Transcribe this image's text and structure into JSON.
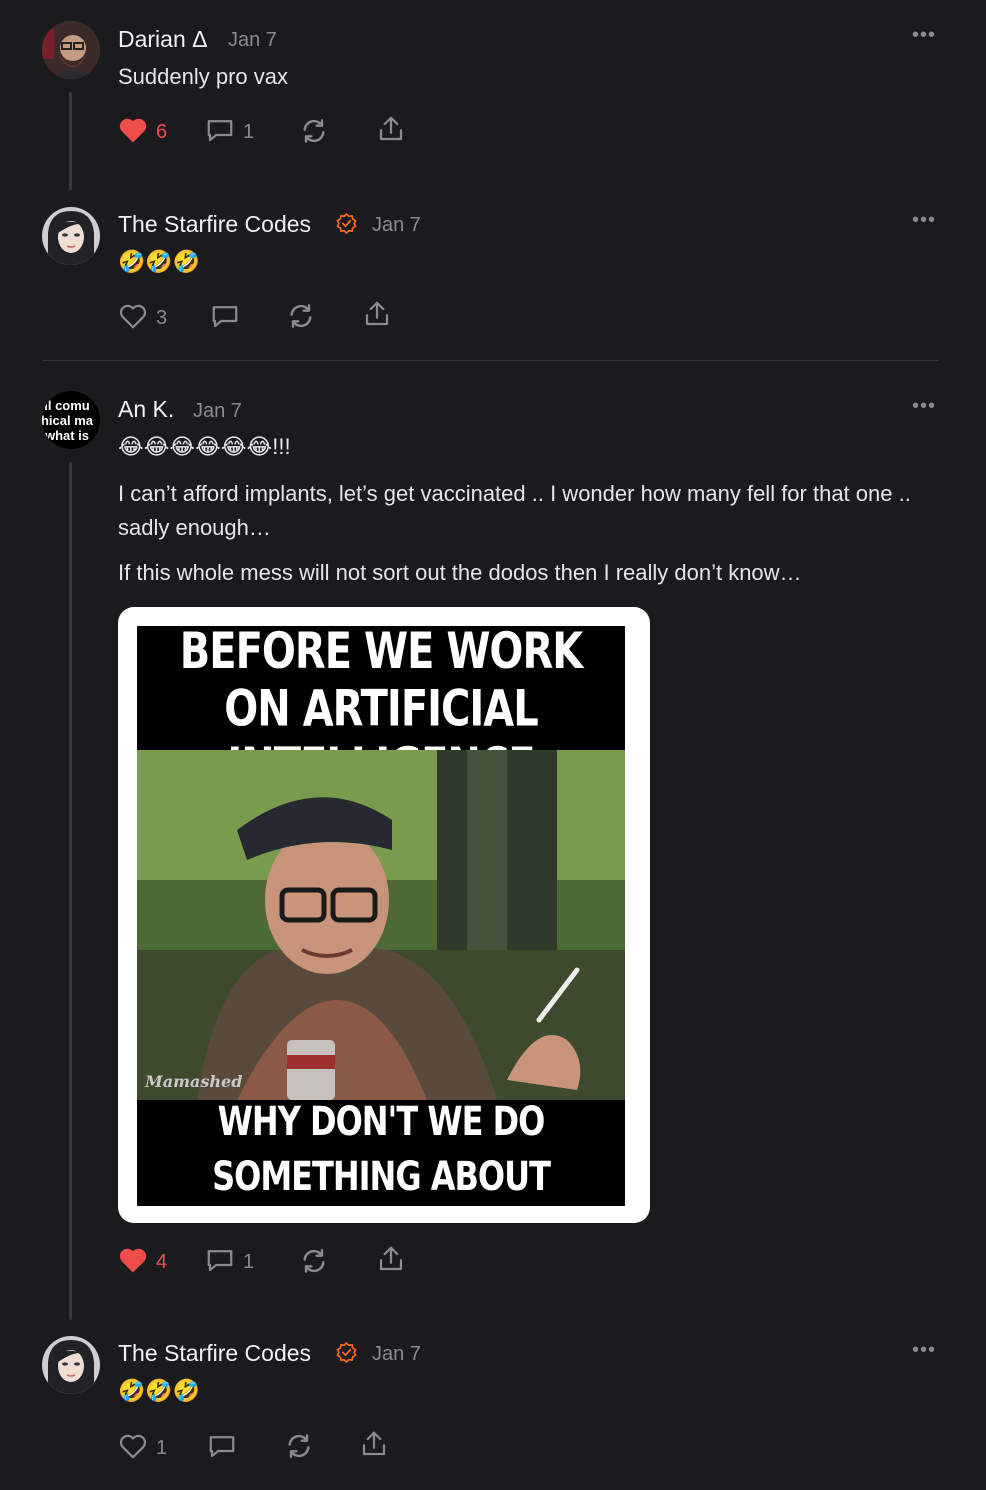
{
  "comments": [
    {
      "author": "Darian Δ",
      "date": "Jan 7",
      "text": "Suddenly pro vax",
      "likes": "6",
      "replies": "1",
      "liked": true
    },
    {
      "author": "The Starfire Codes",
      "date": "Jan 7",
      "text": "🤣🤣🤣",
      "likes": "3",
      "replies": "",
      "liked": false
    },
    {
      "author": "An K.",
      "date": "Jan 7",
      "avatar_text": "ll comu hical ma what is",
      "text_emoji": "😂😂😂😂😂😂!!!",
      "paragraph1": "I can’t afford implants, let’s get vaccinated .. I wonder how many fell for that one .. sadly enough…",
      "paragraph2": "If this whole mess will not sort out the dodos then I really don’t know…",
      "meme_top": "BEFORE WE WORK ON ARTIFICIAL INTELLIGENCE",
      "meme_bottom": "WHY DON'T WE DO SOMETHING ABOUT NATURAL STUPIDITY?",
      "meme_watermark": "Mamashed",
      "likes": "4",
      "replies": "1",
      "liked": true
    },
    {
      "author": "The Starfire Codes",
      "date": "Jan 7",
      "text": "🤣🤣🤣",
      "likes": "1",
      "replies": "",
      "liked": false
    }
  ],
  "more_icon": "more-horizontal-icon",
  "colors": {
    "background": "#1b1b1e",
    "liked": "#ef4c4c",
    "verified": "#ff6719",
    "muted": "#8a8a90"
  }
}
